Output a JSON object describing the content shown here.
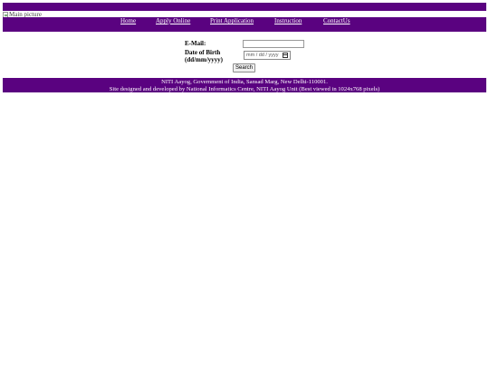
{
  "header": {
    "image_alt": "Main picture",
    "bar_color": "#5a0280"
  },
  "nav": {
    "items": [
      {
        "label": "Home"
      },
      {
        "label": "Apply Online"
      },
      {
        "label": "Print Application"
      },
      {
        "label": "Instruction"
      },
      {
        "label": "ContactUs"
      }
    ]
  },
  "form": {
    "email_label": "E-Mail:",
    "email_value": "",
    "dob_label_line1": "Date of Birth",
    "dob_label_line2": "(dd/mm/yyyy)",
    "dob_placeholder": "mm / dd / yyyy",
    "search_label": "Search"
  },
  "footer": {
    "line1": "NITI Aayog, Government of India, Sansad Marg, New Delhi-110001.",
    "line2": "Site designed and developed by National Informatics Centre, NITI Aayog Unit (Best viewed in 1024x768 pixels)"
  },
  "icons": {
    "header_image": "broken-image-icon",
    "date_picker": "calendar-icon"
  }
}
